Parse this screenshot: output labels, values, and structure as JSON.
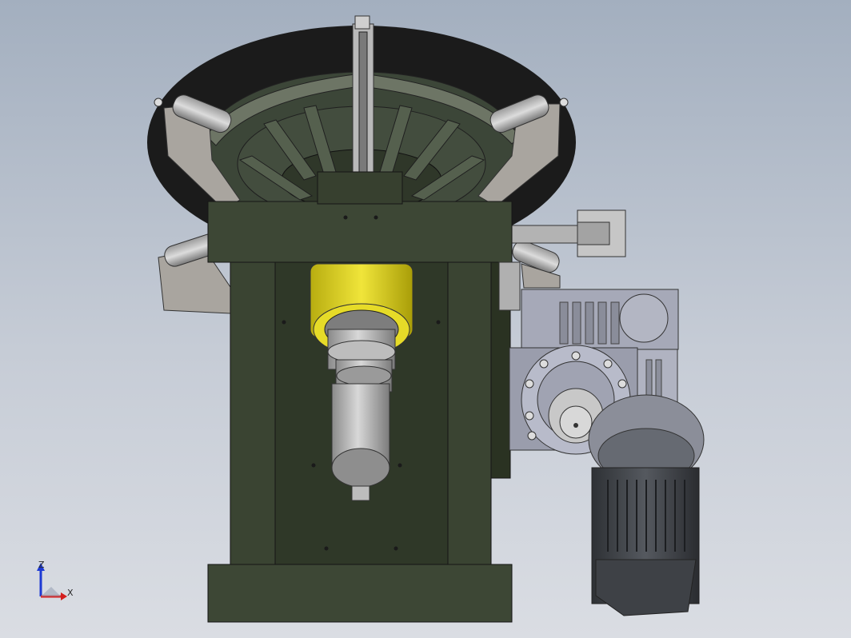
{
  "triad": {
    "z_label": "Z",
    "x_label": "X"
  },
  "colors": {
    "frame": "#3b4534",
    "frame_dark": "#2b3324",
    "tire": "#1a1a1a",
    "motor": "#3a3d42",
    "gearbox": "#9ea2b3",
    "bearing_yellow": "#e0d51c",
    "metal_light": "#c8c8c8",
    "bracket": "#a9a59f"
  }
}
